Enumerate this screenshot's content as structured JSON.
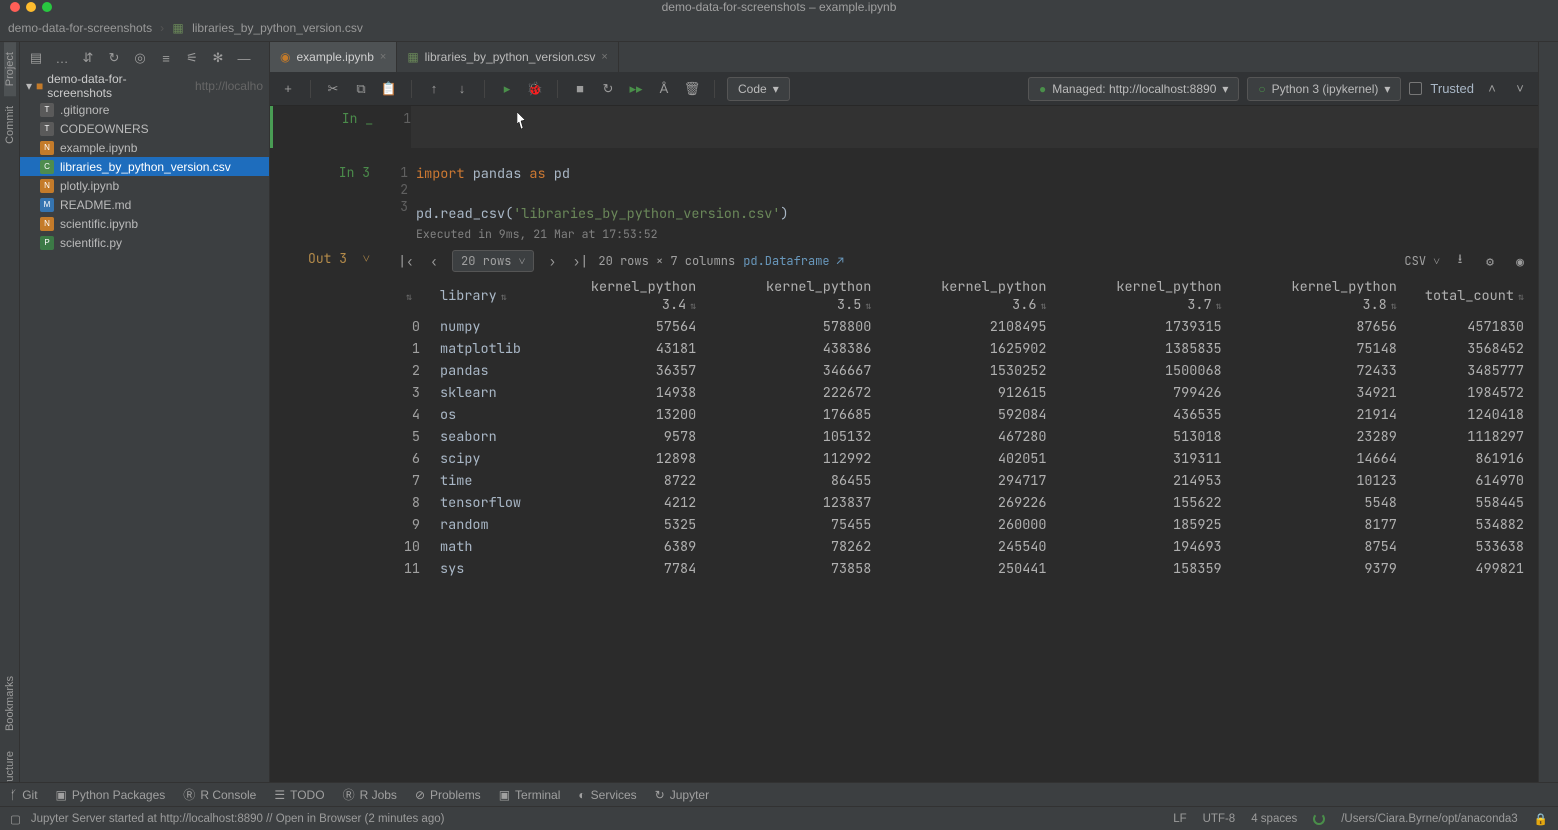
{
  "window": {
    "title": "demo-data-for-screenshots – example.ipynb"
  },
  "breadcrumb": {
    "project": "demo-data-for-screenshots",
    "file": "libraries_by_python_version.csv"
  },
  "left_gutter": {
    "a": "Project",
    "b": "Commit",
    "c": "Bookmarks",
    "d": "Structure"
  },
  "project": {
    "root": "demo-data-for-screenshots",
    "hint": "http://localho",
    "files": [
      ".gitignore",
      "CODEOWNERS",
      "example.ipynb",
      "libraries_by_python_version.csv",
      "plotly.ipynb",
      "README.md",
      "scientific.ipynb",
      "scientific.py"
    ]
  },
  "tabs": {
    "a": "example.ipynb",
    "b": "libraries_by_python_version.csv"
  },
  "nb_toolbar": {
    "cell_type": "Code",
    "managed": "Managed: http://localhost:8890",
    "kernel": "Python 3 (ipykernel)",
    "trusted": "Trusted"
  },
  "cells": {
    "c0": {
      "prompt": "In _",
      "line": "1"
    },
    "c1": {
      "prompt": "In 3",
      "lines": {
        "1": "1",
        "2": "2",
        "3": "3"
      },
      "code": {
        "l1_import": "import",
        "l1_pandas": " pandas ",
        "l1_as": "as",
        "l1_pd": " pd",
        "l3_a": "pd.read_csv(",
        "l3_str": "'libraries_by_python_version.csv'",
        "l3_b": ")"
      },
      "meta": "Executed in 9ms, 21 Mar at 17:53:52"
    },
    "out": {
      "prompt": "Out 3"
    }
  },
  "df_toolbar": {
    "rows_pill": "20 rows",
    "shape": "20 rows × 7 columns",
    "dflink": "pd.Dataframe",
    "csv": "CSV"
  },
  "chart_data": {
    "type": "table",
    "columns": [
      "library",
      "kernel_python 3.4",
      "kernel_python 3.5",
      "kernel_python 3.6",
      "kernel_python 3.7",
      "kernel_python 3.8",
      "total_count"
    ],
    "index": [
      0,
      1,
      2,
      3,
      4,
      5,
      6,
      7,
      8,
      9,
      10,
      11
    ],
    "rows": [
      [
        "numpy",
        57564,
        578800,
        2108495,
        1739315,
        87656,
        4571830
      ],
      [
        "matplotlib",
        43181,
        438386,
        1625902,
        1385835,
        75148,
        3568452
      ],
      [
        "pandas",
        36357,
        346667,
        1530252,
        1500068,
        72433,
        3485777
      ],
      [
        "sklearn",
        14938,
        222672,
        912615,
        799426,
        34921,
        1984572
      ],
      [
        "os",
        13200,
        176685,
        592084,
        436535,
        21914,
        1240418
      ],
      [
        "seaborn",
        9578,
        105132,
        467280,
        513018,
        23289,
        1118297
      ],
      [
        "scipy",
        12898,
        112992,
        402051,
        319311,
        14664,
        861916
      ],
      [
        "time",
        8722,
        86455,
        294717,
        214953,
        10123,
        614970
      ],
      [
        "tensorflow",
        4212,
        123837,
        269226,
        155622,
        5548,
        558445
      ],
      [
        "random",
        5325,
        75455,
        260000,
        185925,
        8177,
        534882
      ],
      [
        "math",
        6389,
        78262,
        245540,
        194693,
        8754,
        533638
      ],
      [
        "sys",
        7784,
        73858,
        250441,
        158359,
        9379,
        499821
      ]
    ]
  },
  "bottom_bar": {
    "git": "Git",
    "pkgs": "Python Packages",
    "rconsole": "R Console",
    "todo": "TODO",
    "rjobs": "R Jobs",
    "problems": "Problems",
    "terminal": "Terminal",
    "services": "Services",
    "jupyter": "Jupyter"
  },
  "status": {
    "msg": "Jupyter Server started at http://localhost:8890 // Open in Browser (2 minutes ago)",
    "le": "LF",
    "enc": "UTF-8",
    "indent": "4 spaces",
    "interp": "/Users/Ciara.Byrne/opt/anaconda3"
  }
}
